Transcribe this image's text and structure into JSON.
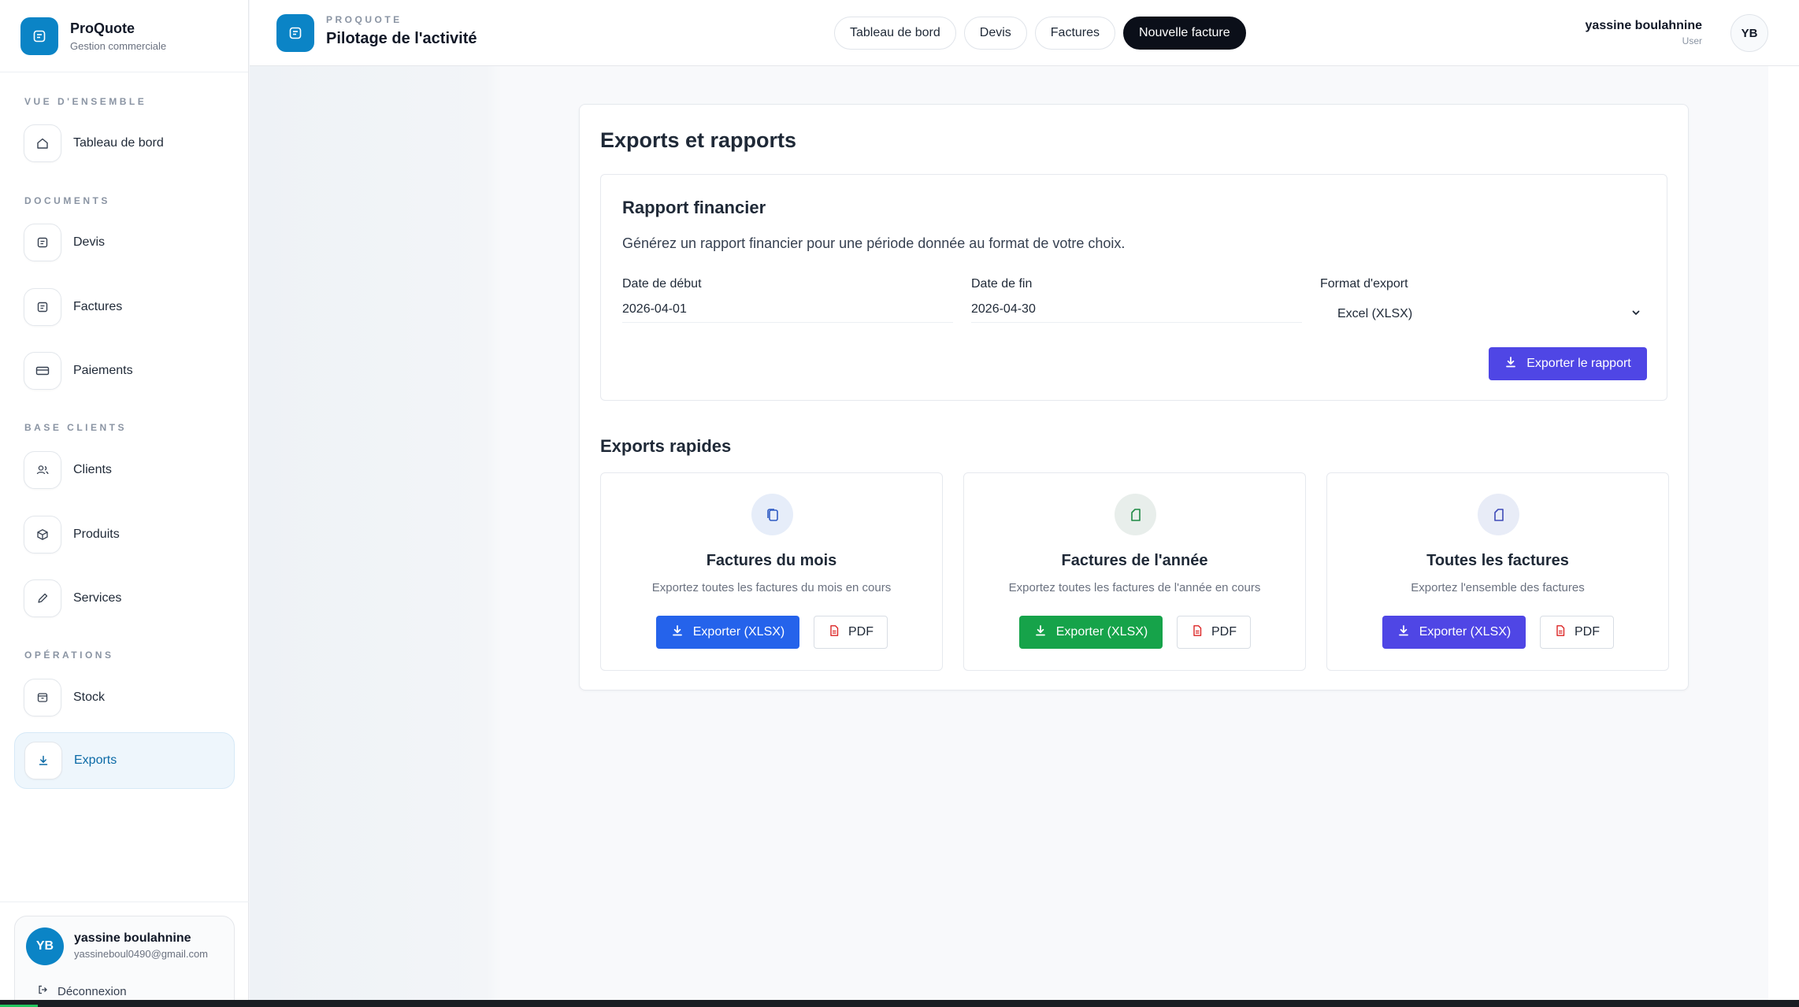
{
  "brand": {
    "name": "ProQuote",
    "subtitle": "Gestion commerciale"
  },
  "sidebar": {
    "sections": [
      {
        "label": "VUE D'ENSEMBLE"
      },
      {
        "label": "DOCUMENTS"
      },
      {
        "label": "BASE CLIENTS"
      },
      {
        "label": "OPÉRATIONS"
      }
    ],
    "items": [
      {
        "label": "Tableau de bord",
        "icon": "home-icon"
      },
      {
        "label": "Devis",
        "icon": "document-icon"
      },
      {
        "label": "Factures",
        "icon": "document-icon"
      },
      {
        "label": "Paiements",
        "icon": "credit-card-icon"
      },
      {
        "label": "Clients",
        "icon": "users-icon"
      },
      {
        "label": "Produits",
        "icon": "box-icon"
      },
      {
        "label": "Services",
        "icon": "pencil-icon"
      },
      {
        "label": "Stock",
        "icon": "archive-icon"
      },
      {
        "label": "Exports",
        "icon": "download-icon",
        "active": true
      }
    ],
    "user": {
      "initials": "YB",
      "name": "yassine boulahnine",
      "email": "yassineboul0490@gmail.com",
      "logout_label": "Déconnexion"
    }
  },
  "header": {
    "eyebrow": "PROQUOTE",
    "title": "Pilotage de l'activité",
    "tabs": [
      {
        "label": "Tableau de bord"
      },
      {
        "label": "Devis"
      },
      {
        "label": "Factures"
      },
      {
        "label": "Nouvelle facture",
        "primary": true
      }
    ],
    "user": {
      "name": "yassine boulahnine",
      "role": "User",
      "initials": "YB"
    }
  },
  "main": {
    "title": "Exports et rapports",
    "report": {
      "title": "Rapport financier",
      "description": "Générez un rapport financier pour une période donnée au format de votre choix.",
      "start_label": "Date de début",
      "start_value": "2026-04-01",
      "end_label": "Date de fin",
      "end_value": "2026-04-30",
      "format_label": "Format d'export",
      "format_value": "Excel (XLSX)",
      "export_button": "Exporter le rapport"
    },
    "quick": {
      "title": "Exports rapides",
      "cards": [
        {
          "title": "Factures du mois",
          "description": "Exportez toutes les factures du mois en cours",
          "xlsx_label": "Exporter (XLSX)",
          "pdf_label": "PDF",
          "color": "#2563eb",
          "icon_bg": "#e6edf9",
          "icon_color": "#2f5bc4"
        },
        {
          "title": "Factures de l'année",
          "description": "Exportez toutes les factures de l'année en cours",
          "xlsx_label": "Exporter (XLSX)",
          "pdf_label": "PDF",
          "color": "#16a34a",
          "icon_bg": "#e8eeeb",
          "icon_color": "#1e8a45"
        },
        {
          "title": "Toutes les factures",
          "description": "Exportez l'ensemble des factures",
          "xlsx_label": "Exporter (XLSX)",
          "pdf_label": "PDF",
          "color": "#4f46e5",
          "icon_bg": "#e8ecf7",
          "icon_color": "#3f4bb8"
        }
      ]
    }
  },
  "colors": {
    "brand": "#0b84c6",
    "primary": "#4f46e5",
    "pdf_icon": "#dc2626"
  }
}
